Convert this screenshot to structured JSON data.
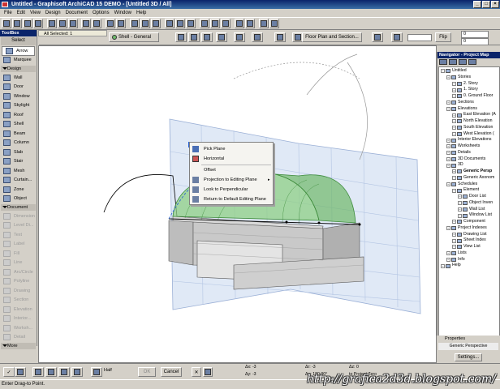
{
  "window": {
    "title": "Untitled - Graphisoft ArchiCAD 15 DEMO - [Untitled 3D / All]",
    "controls": [
      "_",
      "□",
      "×"
    ]
  },
  "menubar": [
    "File",
    "Edit",
    "View",
    "Design",
    "Document",
    "Options",
    "Window",
    "Help"
  ],
  "toolbar": {
    "all_selected_label": "All Selected: 1",
    "shell_dropdown": "Shell - General",
    "floorplan_button": "Floor Plan and Section...",
    "numeric_field": "",
    "flip_label": "Flip",
    "scale_values": [
      "0",
      "0"
    ]
  },
  "toolbox": {
    "title": "ToolBox",
    "select_label": "Select",
    "arrow_label": "Arrow",
    "marquee_label": "Marquee",
    "design_section": "Design",
    "design_tools": [
      "Wall",
      "Door",
      "Window",
      "Skylight",
      "Roof",
      "Shell",
      "Beam",
      "Column",
      "Slab",
      "Stair",
      "Mesh",
      "Curtain...",
      "Zone",
      "Object"
    ],
    "document_section": "Document",
    "document_tools": [
      "Dimension",
      "Level Di...",
      "Text",
      "Label",
      "Fill",
      "Line",
      "Arc/Circle",
      "Polyline",
      "Drawing",
      "Section",
      "Elevation",
      "Interior...",
      "Worksh...",
      "Detail"
    ],
    "more_label": "More"
  },
  "canvas": {
    "tab_label": "All Selected: 1"
  },
  "context_menu": {
    "items": [
      "Pick Plane",
      "Horizontal",
      "Offset",
      "Projection to Editing Plane",
      "Look to Perpendicular",
      "Return to Default Editing Plane"
    ]
  },
  "navigator": {
    "title": "Navigator - Project Map",
    "tree": [
      {
        "label": "Untitled",
        "level": 0
      },
      {
        "label": "Stories",
        "level": 1
      },
      {
        "label": "2. Story",
        "level": 2
      },
      {
        "label": "1. Story",
        "level": 2
      },
      {
        "label": "0. Ground Floor",
        "level": 2
      },
      {
        "label": "Sections",
        "level": 1
      },
      {
        "label": "Elevations",
        "level": 1
      },
      {
        "label": "East Elevation (A",
        "level": 2
      },
      {
        "label": "North Elevation",
        "level": 2
      },
      {
        "label": "South Elevation",
        "level": 2
      },
      {
        "label": "West Elevation (",
        "level": 2
      },
      {
        "label": "Interior Elevations",
        "level": 1
      },
      {
        "label": "Worksheets",
        "level": 1
      },
      {
        "label": "Details",
        "level": 1
      },
      {
        "label": "3D Documents",
        "level": 1
      },
      {
        "label": "3D",
        "level": 1
      },
      {
        "label": "Generic Persp",
        "level": 2,
        "bold": true
      },
      {
        "label": "Generic Axonom",
        "level": 2
      },
      {
        "label": "Schedules",
        "level": 1
      },
      {
        "label": "Element",
        "level": 2
      },
      {
        "label": "Door List",
        "level": 3
      },
      {
        "label": "Object Inven",
        "level": 3
      },
      {
        "label": "Wall List",
        "level": 3
      },
      {
        "label": "Window List",
        "level": 3
      },
      {
        "label": "Component",
        "level": 2
      },
      {
        "label": "Project Indexes",
        "level": 1
      },
      {
        "label": "Drawing List",
        "level": 2
      },
      {
        "label": "Sheet Index",
        "level": 2
      },
      {
        "label": "View List",
        "level": 2
      },
      {
        "label": "Lists",
        "level": 1
      },
      {
        "label": "Info",
        "level": 1
      },
      {
        "label": "Help",
        "level": 0
      }
    ],
    "properties_label": "Properties",
    "properties_value": "Generic Perspective",
    "settings_button": "Settings..."
  },
  "controlbar": {
    "ok_label": "OK",
    "cancel_label": "Cancel",
    "half_label": "Half",
    "dx_label": "Δx: -3",
    "dy_label": "Δy: -3",
    "dr_label": "Δr: -3",
    "da_label": "Δa: 180,00°",
    "dz_label": "Δz: 0",
    "to_project_zero": "to Project Zero"
  },
  "status": "Enter Drag-to Point.",
  "watermark": "http://grafica2d3d.blogspot.com/",
  "colors": {
    "titlebar": "#0a246a",
    "shell_green": "#6fb86a",
    "plane_blue": "#c7d7ee",
    "wall_gray": "#c9c9c9"
  }
}
